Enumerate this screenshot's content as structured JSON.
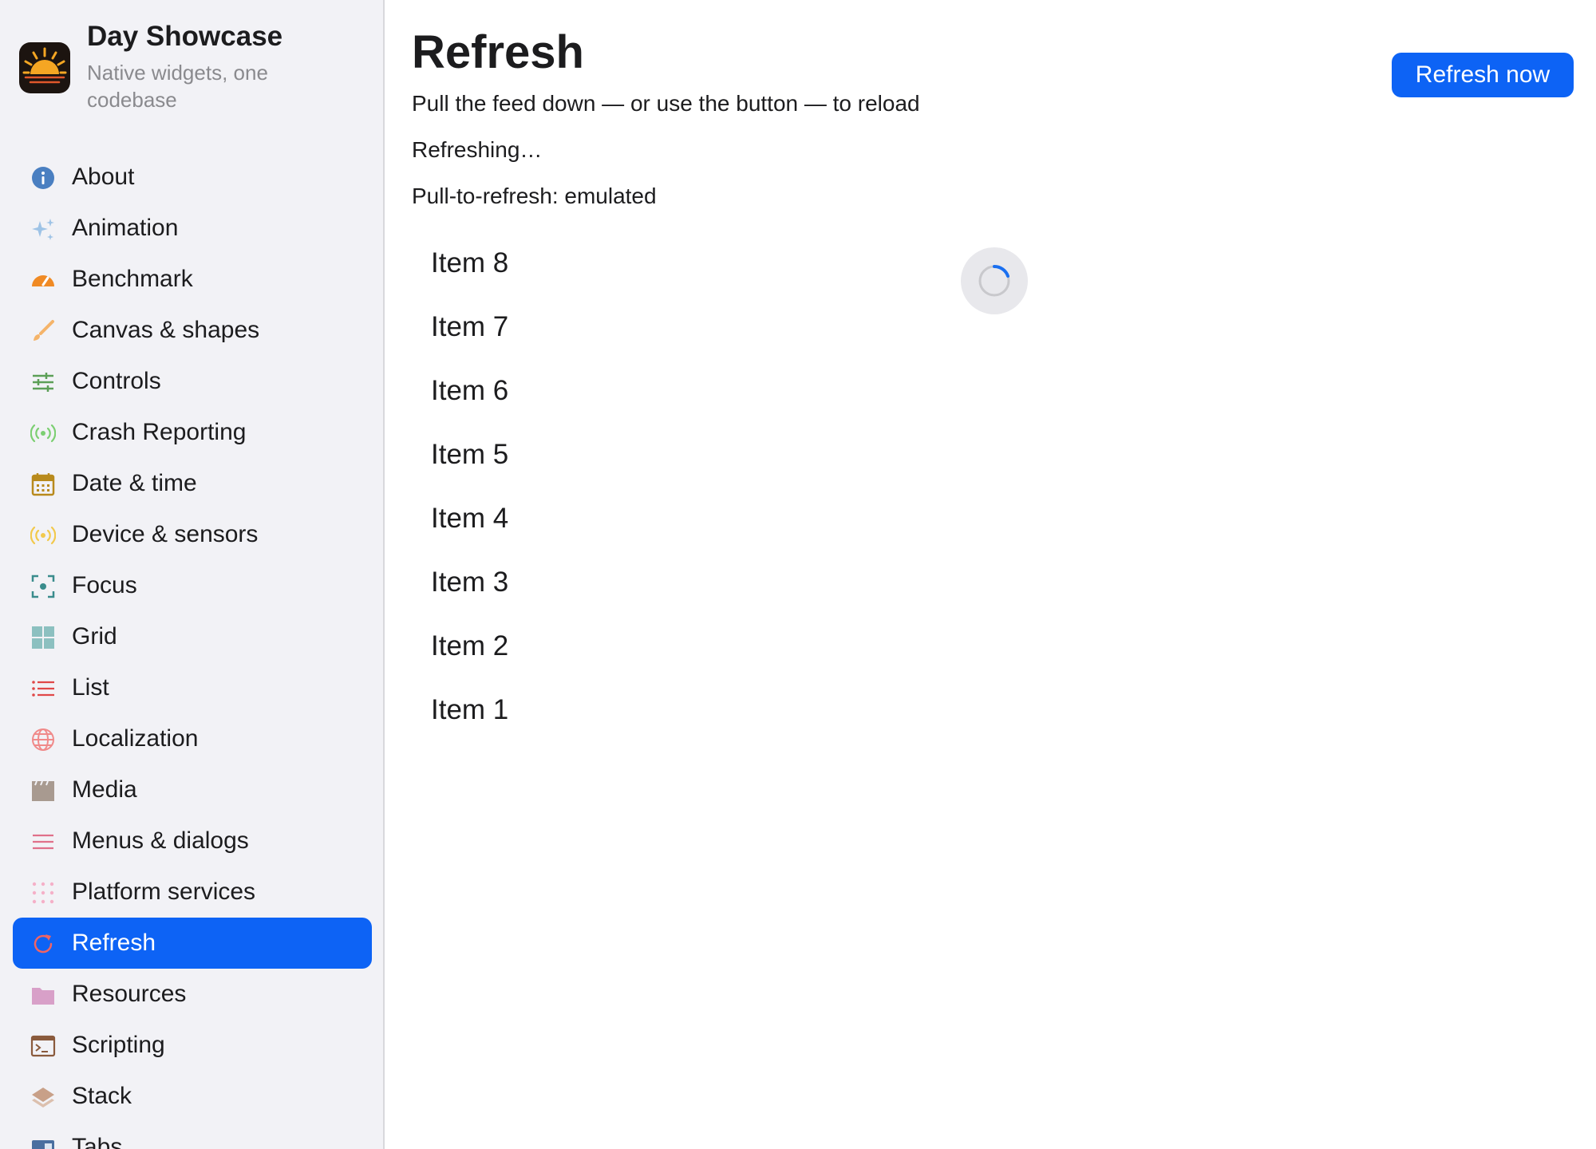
{
  "app": {
    "title": "Day Showcase",
    "subtitle": "Native widgets, one codebase"
  },
  "sidebar": {
    "items": [
      {
        "label": "About",
        "icon": "info-icon",
        "color": "#4a7fc1"
      },
      {
        "label": "Animation",
        "icon": "sparkles-icon",
        "color": "#9ec3e6"
      },
      {
        "label": "Benchmark",
        "icon": "speedometer-icon",
        "color": "#f08a24"
      },
      {
        "label": "Canvas & shapes",
        "icon": "paintbrush-icon",
        "color": "#f5b46a"
      },
      {
        "label": "Controls",
        "icon": "sliders-icon",
        "color": "#5c9f57"
      },
      {
        "label": "Crash Reporting",
        "icon": "broadcast-icon",
        "color": "#7ccf72"
      },
      {
        "label": "Date & time",
        "icon": "calendar-icon",
        "color": "#b88a1c"
      },
      {
        "label": "Device & sensors",
        "icon": "sensor-icon",
        "color": "#f2c94c"
      },
      {
        "label": "Focus",
        "icon": "focus-icon",
        "color": "#3a8c8c"
      },
      {
        "label": "Grid",
        "icon": "grid-icon",
        "color": "#8cc0c0"
      },
      {
        "label": "List",
        "icon": "list-icon",
        "color": "#e04848"
      },
      {
        "label": "Localization",
        "icon": "globe-icon",
        "color": "#f08a8a"
      },
      {
        "label": "Media",
        "icon": "clapperboard-icon",
        "color": "#a89a90"
      },
      {
        "label": "Menus & dialogs",
        "icon": "menu-icon",
        "color": "#e0708a"
      },
      {
        "label": "Platform services",
        "icon": "dots-grid-icon",
        "color": "#f5b0c8"
      },
      {
        "label": "Refresh",
        "icon": "refresh-icon",
        "color": "#f06464",
        "active": true
      },
      {
        "label": "Resources",
        "icon": "folder-icon",
        "color": "#d8a0c8"
      },
      {
        "label": "Scripting",
        "icon": "terminal-icon",
        "color": "#8a5a3c"
      },
      {
        "label": "Stack",
        "icon": "layers-icon",
        "color": "#c8a088"
      },
      {
        "label": "Tabs",
        "icon": "tabs-icon",
        "color": "#4a6fa0"
      }
    ]
  },
  "main": {
    "title": "Refresh",
    "refresh_button": "Refresh now",
    "description": "Pull the feed down — or use the button — to reload",
    "status": "Refreshing…",
    "mode": "Pull-to-refresh: emulated",
    "feed": [
      "Item 8",
      "Item 7",
      "Item 6",
      "Item 5",
      "Item 4",
      "Item 3",
      "Item 2",
      "Item 1"
    ]
  },
  "colors": {
    "accent": "#0d63f5",
    "sidebar_bg": "#f2f2f6",
    "spinner": "#1a6ff0"
  }
}
